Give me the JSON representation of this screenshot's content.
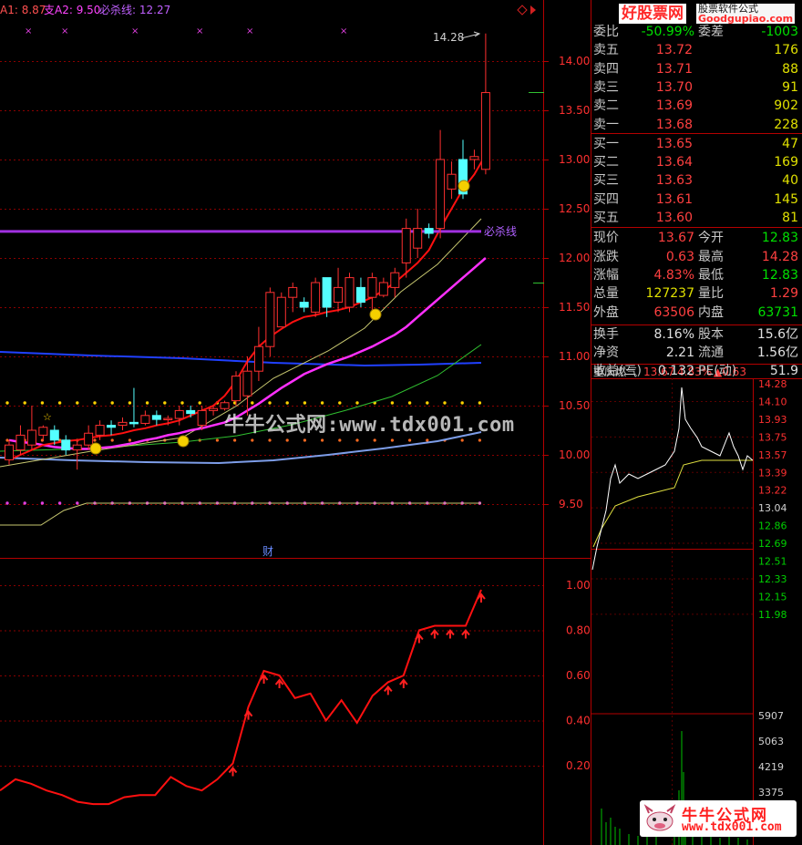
{
  "header": {
    "a1_label": "A1: 8.87",
    "a2_label": "支A2: 9.50",
    "kill_label": "必杀线: 12.27",
    "colors": {
      "a1": "#ff5050",
      "a2": "#ff44ff",
      "kill": "#c060ff"
    }
  },
  "quote": {
    "rows": [
      {
        "l": "委比",
        "v": "-50.99%",
        "vc": "#00e000",
        "r": "委差",
        "rv": "-1003",
        "rvc": "#00e000"
      },
      {
        "l": "卖五",
        "v": "13.72",
        "vc": "#ff4040",
        "rv": "176",
        "rvc": "#e0e000"
      },
      {
        "l": "卖四",
        "v": "13.71",
        "vc": "#ff4040",
        "rv": "88",
        "rvc": "#e0e000"
      },
      {
        "l": "卖三",
        "v": "13.70",
        "vc": "#ff4040",
        "rv": "91",
        "rvc": "#e0e000"
      },
      {
        "l": "卖二",
        "v": "13.69",
        "vc": "#ff4040",
        "rv": "902",
        "rvc": "#e0e000"
      },
      {
        "l": "卖一",
        "v": "13.68",
        "vc": "#ff4040",
        "rv": "228",
        "rvc": "#e0e000"
      },
      {
        "l": "买一",
        "v": "13.65",
        "vc": "#ff4040",
        "rv": "47",
        "rvc": "#e0e000"
      },
      {
        "l": "买二",
        "v": "13.64",
        "vc": "#ff4040",
        "rv": "169",
        "rvc": "#e0e000"
      },
      {
        "l": "买三",
        "v": "13.63",
        "vc": "#ff4040",
        "rv": "40",
        "rvc": "#e0e000"
      },
      {
        "l": "买四",
        "v": "13.61",
        "vc": "#ff4040",
        "rv": "145",
        "rvc": "#e0e000"
      },
      {
        "l": "买五",
        "v": "13.60",
        "vc": "#ff4040",
        "rv": "81",
        "rvc": "#e0e000"
      },
      {
        "l": "现价",
        "v": "13.67",
        "vc": "#ff4040",
        "r": "今开",
        "rv": "12.83",
        "rvc": "#00e000"
      },
      {
        "l": "涨跌",
        "v": "0.63",
        "vc": "#ff4040",
        "r": "最高",
        "rv": "14.28",
        "rvc": "#ff4040"
      },
      {
        "l": "涨幅",
        "v": "4.83%",
        "vc": "#ff4040",
        "r": "最低",
        "rv": "12.83",
        "rvc": "#00e000"
      },
      {
        "l": "总量",
        "v": "127237",
        "vc": "#e0e000",
        "r": "量比",
        "rv": "1.29",
        "rvc": "#ff4040"
      },
      {
        "l": "外盘",
        "v": "63506",
        "vc": "#ff4040",
        "r": "内盘",
        "rv": "63731",
        "rvc": "#00e000"
      },
      {
        "l": "换手",
        "v": "8.16%",
        "vc": "#e0e0e0",
        "r": "股本",
        "rv": "15.6亿",
        "rvc": "#e0e0e0"
      },
      {
        "l": "净资",
        "v": "2.21",
        "vc": "#e0e0e0",
        "r": "流通",
        "rv": "1.56亿",
        "rvc": "#e0e0e0"
      },
      {
        "l": "收益(三)",
        "v": "0.132",
        "vc": "#e0e0e0",
        "r": "PE(动)",
        "rv": "51.9",
        "rvc": "#e0e0e0"
      }
    ]
  },
  "intraday": {
    "name": "重庆燃气",
    "price": "13.67",
    "pct": "4.83%",
    "chg": "▲0.63",
    "price_ticks": [
      "14.28",
      "14.10",
      "13.93",
      "13.75",
      "13.57",
      "13.39",
      "13.22",
      "13.04",
      "12.86",
      "12.69",
      "12.51",
      "12.33",
      "12.15",
      "11.98"
    ],
    "vol_ticks": [
      "5907",
      "5063",
      "4219",
      "3375"
    ]
  },
  "annotations": {
    "kill_line_text": "必杀线",
    "high_text": "14.28",
    "cai_text": "财"
  },
  "watermark": "牛牛公式网:www.tdx001.com",
  "branding": {
    "top_main": "好股票网",
    "top_sub": "Goodgupiao.com",
    "top_side": "股票软件公式",
    "bottom_main": "牛牛公式网",
    "bottom_url": "www.tdx001.com"
  },
  "chart_data": [
    {
      "type": "candlestick",
      "title": "",
      "yticks": [
        "14.00",
        "13.50",
        "13.00",
        "12.50",
        "12.00",
        "11.50",
        "11.00",
        "10.50",
        "10.00",
        "9.50"
      ],
      "ylim": [
        9.2,
        14.5
      ],
      "kill_line": 12.27,
      "candles": [
        [
          9.95,
          10.1,
          9.9,
          10.15
        ],
        [
          10.05,
          10.2,
          10.0,
          10.3
        ],
        [
          10.1,
          10.25,
          10.05,
          10.5
        ],
        [
          10.2,
          10.28,
          10.15,
          10.3
        ],
        [
          10.25,
          10.15,
          10.1,
          10.3
        ],
        [
          10.15,
          10.05,
          10.0,
          10.2
        ],
        [
          10.05,
          10.1,
          9.85,
          10.15
        ],
        [
          10.1,
          10.22,
          10.05,
          10.3
        ],
        [
          10.2,
          10.3,
          10.15,
          10.35
        ],
        [
          10.3,
          10.28,
          10.2,
          10.35
        ],
        [
          10.3,
          10.33,
          10.25,
          10.38
        ],
        [
          10.33,
          10.32,
          10.28,
          10.68
        ],
        [
          10.32,
          10.4,
          10.3,
          10.45
        ],
        [
          10.4,
          10.36,
          10.3,
          10.45
        ],
        [
          10.36,
          10.37,
          10.3,
          10.4
        ],
        [
          10.37,
          10.45,
          10.3,
          10.5
        ],
        [
          10.45,
          10.42,
          10.38,
          10.5
        ],
        [
          10.3,
          10.45,
          10.25,
          10.5
        ],
        [
          10.45,
          10.47,
          10.4,
          10.5
        ],
        [
          10.47,
          10.53,
          10.45,
          10.55
        ],
        [
          10.55,
          10.8,
          10.5,
          10.85
        ],
        [
          10.6,
          10.85,
          10.4,
          11.0
        ],
        [
          10.85,
          11.1,
          10.75,
          11.3
        ],
        [
          11.1,
          11.65,
          11.0,
          11.7
        ],
        [
          11.3,
          11.6,
          11.3,
          11.65
        ],
        [
          11.6,
          11.7,
          11.45,
          11.75
        ],
        [
          11.55,
          11.5,
          11.45,
          11.6
        ],
        [
          11.45,
          11.75,
          11.4,
          11.8
        ],
        [
          11.8,
          11.5,
          11.4,
          11.8
        ],
        [
          11.55,
          11.7,
          11.45,
          11.9
        ],
        [
          11.5,
          11.8,
          11.45,
          11.85
        ],
        [
          11.7,
          11.55,
          11.5,
          11.8
        ],
        [
          11.6,
          11.8,
          11.4,
          11.85
        ],
        [
          11.62,
          11.75,
          11.6,
          11.8
        ],
        [
          11.7,
          11.85,
          11.6,
          11.9
        ],
        [
          11.95,
          12.3,
          11.8,
          12.4
        ],
        [
          12.1,
          12.3,
          12.0,
          12.5
        ],
        [
          12.3,
          12.25,
          12.2,
          12.35
        ],
        [
          12.3,
          13.0,
          12.2,
          13.3
        ],
        [
          12.7,
          12.85,
          12.6,
          12.98
        ],
        [
          13.0,
          12.65,
          12.6,
          13.2
        ],
        [
          13.0,
          13.03,
          12.9,
          13.1
        ],
        [
          12.9,
          13.68,
          12.85,
          14.28
        ]
      ],
      "ma_red": [
        9.95,
        10.0,
        10.05,
        10.1,
        10.12,
        10.14,
        10.15,
        10.17,
        10.19,
        10.2,
        10.22,
        10.25,
        10.27,
        10.3,
        10.32,
        10.35,
        10.4,
        10.45,
        10.5,
        10.6,
        10.75,
        10.95,
        11.1,
        11.2,
        11.28,
        11.35,
        11.4,
        11.42,
        11.45,
        11.47,
        11.5,
        11.55,
        11.6,
        11.67,
        11.75,
        11.85,
        11.95,
        12.08,
        12.3,
        12.5,
        12.7,
        12.85,
        13.05
      ],
      "ma_magenta": [
        10.15,
        10.13,
        10.12,
        10.1,
        10.08,
        10.07,
        10.06,
        10.06,
        10.07,
        10.08,
        10.1,
        10.12,
        10.15,
        10.17,
        10.2,
        10.22,
        10.25,
        10.27,
        10.3,
        10.33,
        10.38,
        10.45,
        10.52,
        10.6,
        10.68,
        10.75,
        10.82,
        10.87,
        10.92,
        10.96,
        11.0,
        11.05,
        11.1,
        11.16,
        11.22,
        11.3,
        11.4,
        11.5,
        11.6,
        11.7,
        11.8,
        11.9,
        12.0
      ],
      "ma_blue": [
        11.05,
        11.04,
        11.03,
        11.02,
        11.01,
        11.0,
        10.99,
        10.98,
        10.97,
        10.96,
        10.95,
        10.94,
        10.93,
        10.92,
        10.92,
        10.91,
        10.9,
        10.9,
        10.9,
        10.9,
        10.9,
        10.9,
        10.9,
        10.9,
        10.9,
        10.9,
        10.92,
        10.93,
        10.94,
        10.95,
        10.95,
        10.96,
        10.96,
        10.97,
        10.97,
        10.98,
        10.98,
        10.98,
        10.99,
        10.99,
        11.0,
        11.0,
        11.0
      ]
    },
    {
      "type": "line",
      "title": "",
      "yticks": [
        "1.00",
        "0.80",
        "0.60",
        "0.40",
        "0.20"
      ],
      "ylim": [
        0.0,
        1.07
      ],
      "values": [
        0.09,
        0.14,
        0.12,
        0.09,
        0.07,
        0.04,
        0.03,
        0.03,
        0.06,
        0.07,
        0.07,
        0.15,
        0.11,
        0.09,
        0.14,
        0.21,
        0.46,
        0.62,
        0.6,
        0.5,
        0.52,
        0.4,
        0.49,
        0.39,
        0.51,
        0.57,
        0.6,
        0.8,
        0.82,
        0.82,
        0.82,
        0.98
      ]
    }
  ]
}
